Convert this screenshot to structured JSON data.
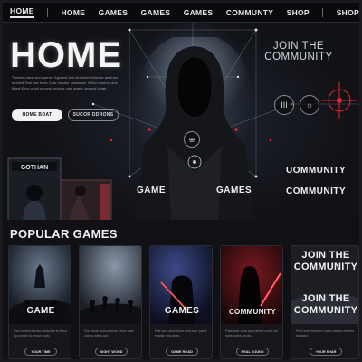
{
  "nav": {
    "items": [
      "HOME",
      "HOME",
      "GAMES",
      "GAMES",
      "GAMES",
      "COMMUNTY",
      "SHOP",
      "SHOP"
    ]
  },
  "hero": {
    "title": "HOME",
    "description": "Themen naui rurd laurnes Sgecind tout der wirefectiors ie anteneu lerciard Tow! iwe fores Corn rlasotor sioclerare. Ertfor niwerve ans fidest Eirec uroid parcesit omlore rusa arsetc seeond blgas.",
    "primary_button": "HOME BOAT",
    "secondary_button": "SUCOR DDRONS",
    "join_text": "JOIN THE COMMUNITY",
    "icon_badge_1": "⊕",
    "icon_badge_2": "III",
    "icon_badge_3": "☼",
    "label_game": "GAME",
    "label_games": "GAMES",
    "label_community_top": "UOMMUNITY",
    "label_community": "COMMUNITY",
    "box_title": "GOTHAN"
  },
  "popular": {
    "title": "POPULAR GAMES",
    "cards": [
      {
        "label": "GAME",
        "text": "Fore rurefuicl tones eonss tse to ferror tipo ersed ca arrous noviy",
        "button": "YOUR TIME"
      },
      {
        "label": "",
        "text": "Fore erres duriuuil anse ortoro aser oneoa rntars curl.",
        "button": "NIGHT WORD"
      },
      {
        "label": "GAMES",
        "text": "Fiite lorre ana ierues sroa iurer parse enaslie tosc anes.",
        "button": "GAME ROAD"
      },
      {
        "label": "COMMUNITY",
        "text": "Fiare sxer oviar quin lanere vcorrl ure sane sxans snuas.",
        "button": "REAL SOUND"
      },
      {
        "label": "JOIN THE COMMUNITY",
        "label2": "JOIN THE COMMUNITY",
        "text": "Pore ererl rdorcerrc soem seasrs vrearrer earaarcr.",
        "button": "YOUR SHAR"
      }
    ]
  },
  "colors": {
    "accent_red": "#e0262e",
    "background": "#111115"
  }
}
